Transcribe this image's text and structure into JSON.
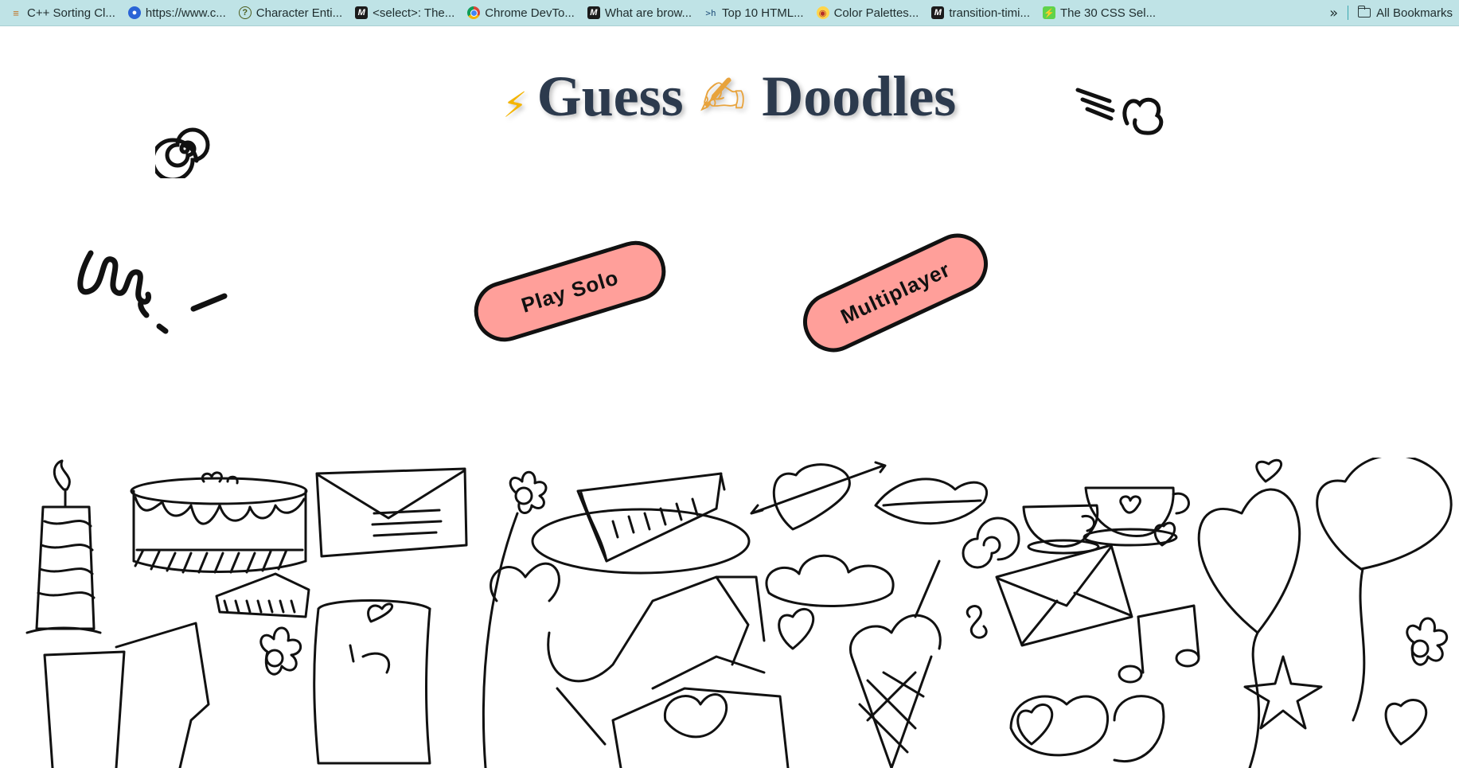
{
  "bookmarks": [
    {
      "label": "C++ Sorting Cl...",
      "icon": "stack-icon",
      "icon_glyph": "≡"
    },
    {
      "label": "https://www.c...",
      "icon": "globe-icon",
      "icon_glyph": "●"
    },
    {
      "label": "Character Enti...",
      "icon": "question-icon",
      "icon_glyph": "?"
    },
    {
      "label": "<select>: The...",
      "icon": "mdn-icon",
      "icon_glyph": "M"
    },
    {
      "label": "Chrome DevTo...",
      "icon": "chrome-icon",
      "icon_glyph": ""
    },
    {
      "label": "What are brow...",
      "icon": "mdn-icon",
      "icon_glyph": "M"
    },
    {
      "label": "Top 10 HTML...",
      "icon": "terminal-icon",
      "icon_glyph": ">h"
    },
    {
      "label": "Color Palettes...",
      "icon": "owl-icon",
      "icon_glyph": "◉"
    },
    {
      "label": "transition-timi...",
      "icon": "mdn-icon",
      "icon_glyph": "M"
    },
    {
      "label": "The 30 CSS Sel...",
      "icon": "bolt-icon",
      "icon_glyph": "⚡"
    }
  ],
  "bookmarks_more": "»",
  "all_bookmarks_label": "All Bookmarks",
  "title": {
    "lead_emoji": "⚡",
    "word1": "Guess",
    "mid_emoji": "✍",
    "word2": "Doodles"
  },
  "buttons": {
    "play_solo": "Play Solo",
    "multiplayer": "Multiplayer"
  },
  "colors": {
    "bookmarks_bar": "#bfe3e6",
    "title": "#2c3a4d",
    "button_fill": "#ff9f9a",
    "button_border": "#111111"
  }
}
